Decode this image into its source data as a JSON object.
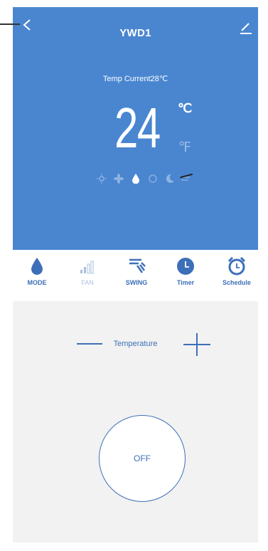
{
  "header": {
    "title": "YWD1",
    "temp_current": "Temp Current28℃",
    "setpoint": "24",
    "unit_c": "℃",
    "unit_f": "℉",
    "mode_icons": [
      "sun-icon",
      "fan-icon",
      "drop-icon",
      "snowflake-icon",
      "moon-icon",
      "wind-icon"
    ],
    "selected_mode_icon": "drop-icon"
  },
  "tabs": [
    {
      "label": "MODE",
      "icon": "drop-icon",
      "active": true
    },
    {
      "label": "FAN",
      "icon": "signal-bars-icon",
      "active": false
    },
    {
      "label": "SWING",
      "icon": "swing-icon",
      "active": true
    },
    {
      "label": "Timer",
      "icon": "clock-icon",
      "active": true
    },
    {
      "label": "Schedule",
      "icon": "alarm-clock-icon",
      "active": true
    }
  ],
  "temperature": {
    "label": "Temperature"
  },
  "power": {
    "label": "OFF"
  },
  "colors": {
    "accent": "#3d6fb8",
    "header_bg": "#4a86d0",
    "panel_bg": "#f2f2f2"
  }
}
